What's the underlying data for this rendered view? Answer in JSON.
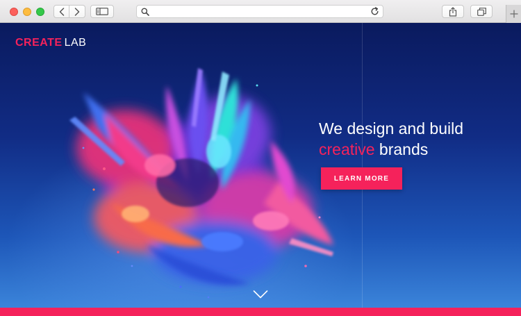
{
  "browser": {
    "address_value": "",
    "address_placeholder": "",
    "colors": {
      "close": "#fc605c",
      "minimize": "#fdbc40",
      "maximize": "#34c84a"
    },
    "icons": {
      "back": "chevron-left-icon",
      "forward": "chevron-right-icon",
      "sidebar": "sidebar-icon",
      "search": "search-icon",
      "reload": "reload-icon",
      "share": "share-icon",
      "tabs": "tabs-icon",
      "new_tab": "plus-icon"
    }
  },
  "page": {
    "logo": {
      "primary": "CREATE",
      "secondary": "LAB"
    },
    "headline": {
      "line1": "We design and build",
      "accent": "creative",
      "line2_rest": " brands"
    },
    "cta_label": "LEARN MORE",
    "scroll_icon": "chevron-down-icon",
    "colors": {
      "accent": "#f5225b",
      "background_top": "#0a1a5e",
      "background_bottom": "#3b84da",
      "text": "#ffffff"
    }
  }
}
